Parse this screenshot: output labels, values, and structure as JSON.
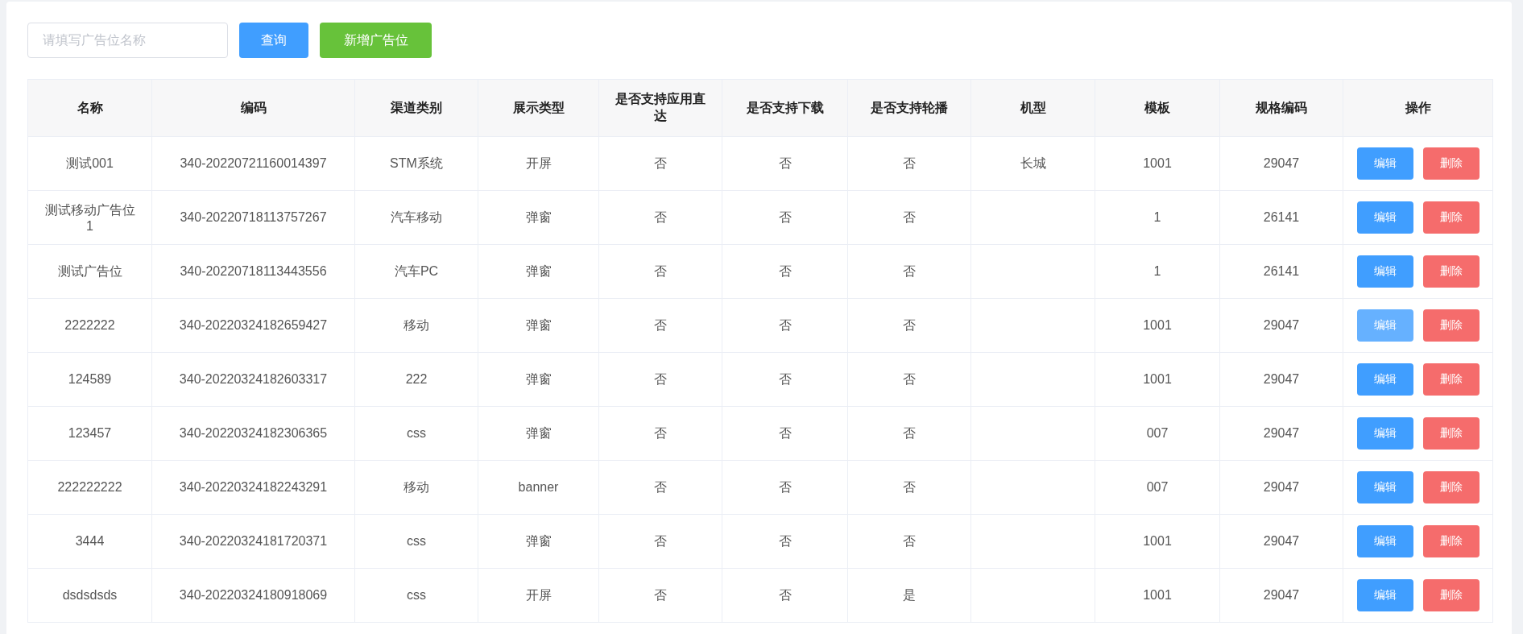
{
  "search": {
    "placeholder": "请填写广告位名称"
  },
  "buttons": {
    "query": "查询",
    "add": "新增广告位"
  },
  "table": {
    "columns": [
      "名称",
      "编码",
      "渠道类别",
      "展示类型",
      "是否支持应用直达",
      "是否支持下载",
      "是否支持轮播",
      "机型",
      "模板",
      "规格编码",
      "操作"
    ],
    "rows": [
      {
        "cells": [
          "测试001",
          "340-20220721160014397",
          "STM系统",
          "开屏",
          "否",
          "否",
          "否",
          "长城",
          "1001",
          "29047"
        ],
        "edit": "编辑",
        "delete": "删除",
        "edit_hovered": false
      },
      {
        "cells": [
          "测试移动广告位1",
          "340-20220718113757267",
          "汽车移动",
          "弹窗",
          "否",
          "否",
          "否",
          "",
          "1",
          "26141"
        ],
        "edit": "编辑",
        "delete": "删除",
        "edit_hovered": false
      },
      {
        "cells": [
          "测试广告位",
          "340-20220718113443556",
          "汽车PC",
          "弹窗",
          "否",
          "否",
          "否",
          "",
          "1",
          "26141"
        ],
        "edit": "编辑",
        "delete": "删除",
        "edit_hovered": false
      },
      {
        "cells": [
          "2222222",
          "340-20220324182659427",
          "移动",
          "弹窗",
          "否",
          "否",
          "否",
          "",
          "1001",
          "29047"
        ],
        "edit": "编辑",
        "delete": "删除",
        "edit_hovered": true
      },
      {
        "cells": [
          "124589",
          "340-20220324182603317",
          "222",
          "弹窗",
          "否",
          "否",
          "否",
          "",
          "1001",
          "29047"
        ],
        "edit": "编辑",
        "delete": "删除",
        "edit_hovered": false
      },
      {
        "cells": [
          "123457",
          "340-20220324182306365",
          "css",
          "弹窗",
          "否",
          "否",
          "否",
          "",
          "007",
          "29047"
        ],
        "edit": "编辑",
        "delete": "删除",
        "edit_hovered": false
      },
      {
        "cells": [
          "222222222",
          "340-20220324182243291",
          "移动",
          "banner",
          "否",
          "否",
          "否",
          "",
          "007",
          "29047"
        ],
        "edit": "编辑",
        "delete": "删除",
        "edit_hovered": false
      },
      {
        "cells": [
          "3444",
          "340-20220324181720371",
          "css",
          "弹窗",
          "否",
          "否",
          "否",
          "",
          "1001",
          "29047"
        ],
        "edit": "编辑",
        "delete": "删除",
        "edit_hovered": false
      },
      {
        "cells": [
          "dsdsdsds",
          "340-20220324180918069",
          "css",
          "开屏",
          "否",
          "否",
          "是",
          "",
          "1001",
          "29047"
        ],
        "edit": "编辑",
        "delete": "删除",
        "edit_hovered": false
      }
    ]
  }
}
